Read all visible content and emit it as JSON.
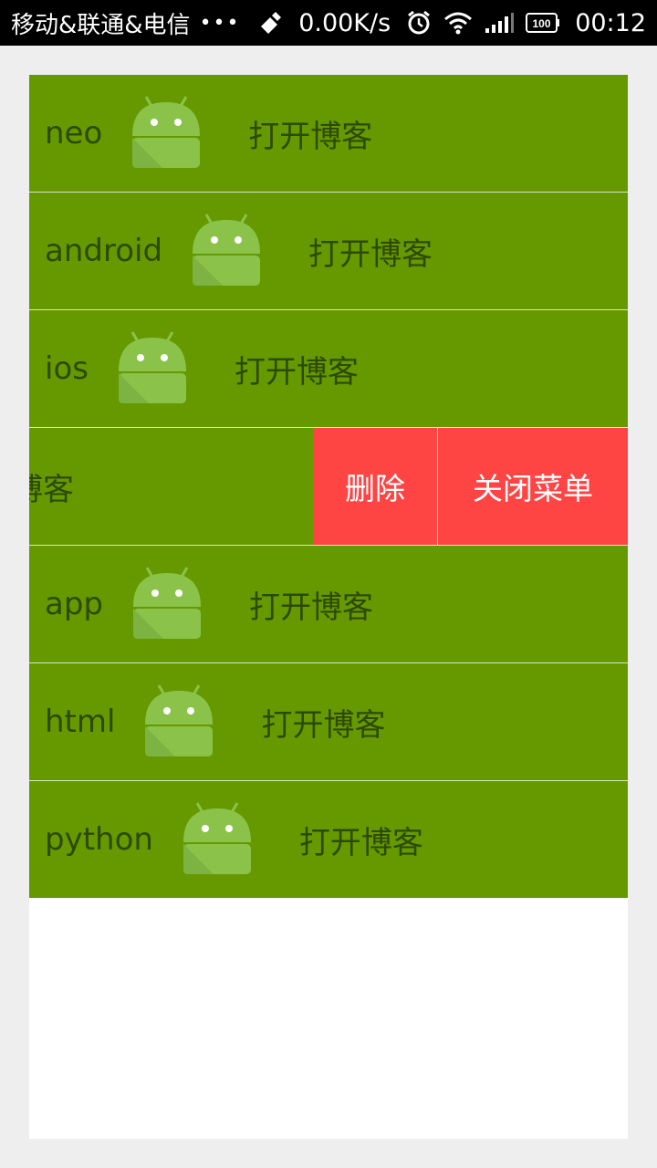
{
  "statusbar": {
    "carrier": "移动&联通&电信",
    "dots": "•••",
    "net_speed": "0.00K/s",
    "battery": "100",
    "time": "00:12"
  },
  "list": {
    "items": [
      {
        "name": "neo",
        "action": "打开博客"
      },
      {
        "name": "android",
        "action": "打开博客"
      },
      {
        "name": "ios",
        "action": "打开博客"
      },
      {
        "name": "",
        "action": "打开博客"
      },
      {
        "name": "app",
        "action": "打开博客"
      },
      {
        "name": "html",
        "action": "打开博客"
      },
      {
        "name": "python",
        "action": "打开博客"
      }
    ],
    "swipe_menu": {
      "delete_label": "删除",
      "close_label": "关闭菜单"
    }
  },
  "colors": {
    "row_bg": "#669900",
    "row_text": "#2c4a00",
    "menu_bg": "#ff4444",
    "menu_text": "#ffffff"
  }
}
